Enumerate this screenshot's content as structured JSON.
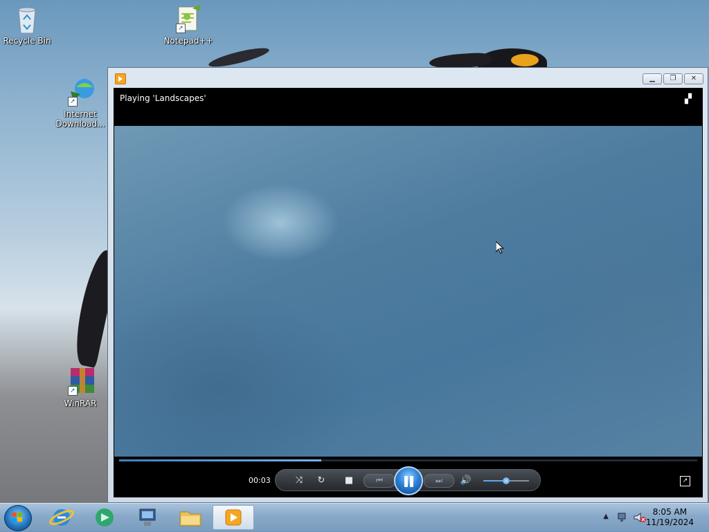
{
  "desktop": {
    "icons": [
      {
        "label": "Recycle Bin"
      },
      {
        "label": "Notepad++"
      },
      {
        "label": "Internet Download..."
      },
      {
        "label": "WinRAR"
      }
    ]
  },
  "player": {
    "now_playing": "Playing 'Landscapes'",
    "elapsed": "00:03",
    "progress": 0.35,
    "volume": 0.5,
    "state": "playing",
    "window_buttons": [
      "minimize",
      "maximize",
      "close"
    ],
    "controls": [
      "shuffle-icon",
      "repeat-icon",
      "stop-icon",
      "previous-icon",
      "pause-icon",
      "next-icon",
      "volume-icon",
      "fullscreen-icon"
    ]
  },
  "taskbar": {
    "pinned": [
      "internet-explorer-icon",
      "media-center-icon",
      "network-icon",
      "file-explorer-icon",
      "windows-media-player-icon"
    ],
    "active": "windows-media-player-icon",
    "clock": {
      "time": "8:05 AM",
      "date": "11/19/2024"
    }
  },
  "colors": {
    "accent": "#2f82d6",
    "seek_fill": "#5aa8ec"
  }
}
